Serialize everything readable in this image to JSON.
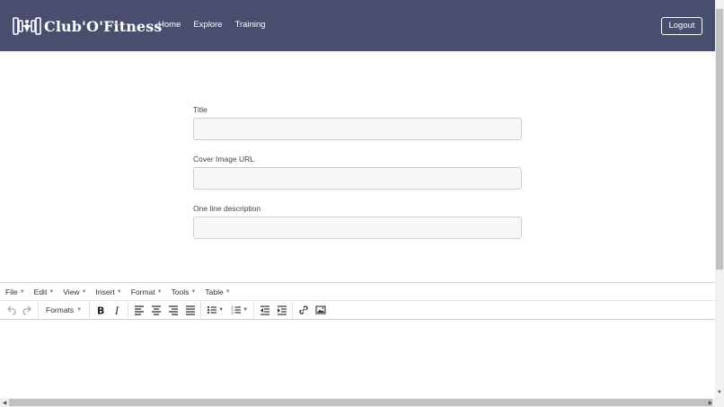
{
  "navbar": {
    "brand": "Club'O'Fitness",
    "brand_icon": "dumbbell-logo",
    "links": [
      "Home",
      "Explore",
      "Training"
    ],
    "logout_label": "Logout",
    "background": "#4a4e6e"
  },
  "form": {
    "title_label": "Title",
    "title_value": "",
    "cover_label": "Cover Image URL",
    "cover_value": "",
    "description_label": "One line description",
    "description_value": ""
  },
  "editor": {
    "menus": [
      "File",
      "Edit",
      "View",
      "Insert",
      "Format",
      "Tools",
      "Table"
    ],
    "formats_label": "Formats",
    "toolbar_icons": [
      "undo-icon",
      "redo-icon",
      "bold-icon",
      "italic-icon",
      "align-left-icon",
      "align-center-icon",
      "align-right-icon",
      "align-justify-icon",
      "bullet-list-icon",
      "numbered-list-icon",
      "outdent-icon",
      "indent-icon",
      "link-icon",
      "image-icon"
    ],
    "content": ""
  }
}
